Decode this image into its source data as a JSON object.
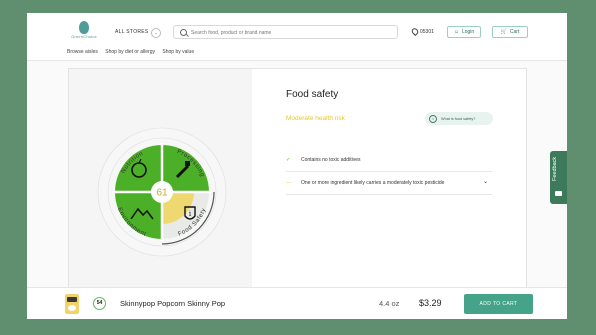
{
  "header": {
    "logo_text": "GreenChoice",
    "store_selector": "ALL STORES",
    "search_placeholder": "Search food, product or brand name",
    "zip": "05301",
    "login_label": "Login",
    "cart_label": "Cart",
    "nav": [
      "Browse aisles",
      "Shop by diet or allergy",
      "Shop by value"
    ]
  },
  "wheel": {
    "score": "61",
    "segments": [
      "Nutrition",
      "Processing",
      "Food Safety",
      "Environment"
    ],
    "colors": {
      "good": "#4caf28",
      "moderate": "#f0d870",
      "neutral": "#e8eae8"
    }
  },
  "detail": {
    "title": "Food safety",
    "risk_label": "Moderate health risk",
    "what_is_label": "What is food safety?",
    "items": [
      {
        "mark": "✓",
        "text": "Contains no toxic additives"
      },
      {
        "mark": "—",
        "text": "One or more ingredient likely carries a moderately toxic pesticide"
      }
    ]
  },
  "product": {
    "score": "54",
    "name": "Skinnypop Popcorn Skinny Pop",
    "size": "4.4 oz",
    "price": "$3.29",
    "add_label": "ADD TO CART"
  },
  "feedback": {
    "label": "Feedback"
  }
}
